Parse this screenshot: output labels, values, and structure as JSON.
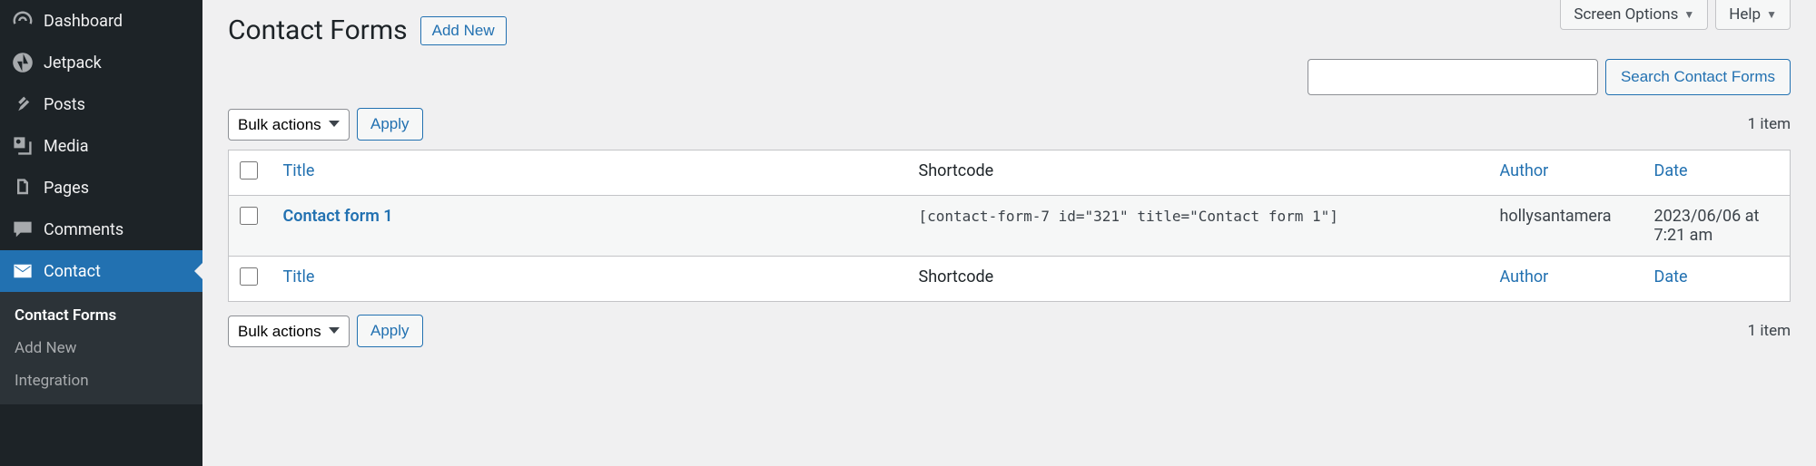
{
  "top": {
    "screen_options": "Screen Options",
    "help": "Help"
  },
  "sidebar": {
    "items": [
      {
        "label": "Dashboard"
      },
      {
        "label": "Jetpack"
      },
      {
        "label": "Posts"
      },
      {
        "label": "Media"
      },
      {
        "label": "Pages"
      },
      {
        "label": "Comments"
      },
      {
        "label": "Contact"
      }
    ],
    "submenu": [
      {
        "label": "Contact Forms"
      },
      {
        "label": "Add New"
      },
      {
        "label": "Integration"
      }
    ]
  },
  "page": {
    "title": "Contact Forms",
    "add_new": "Add New"
  },
  "search": {
    "value": "",
    "button": "Search Contact Forms"
  },
  "bulk": {
    "label": "Bulk actions",
    "apply": "Apply"
  },
  "count_text": "1 item",
  "columns": {
    "title": "Title",
    "shortcode": "Shortcode",
    "author": "Author",
    "date": "Date"
  },
  "rows": [
    {
      "title": "Contact form 1",
      "shortcode": "[contact-form-7 id=\"321\" title=\"Contact form 1\"]",
      "author": "hollysantamera",
      "date": "2023/06/06 at 7:21 am"
    }
  ]
}
